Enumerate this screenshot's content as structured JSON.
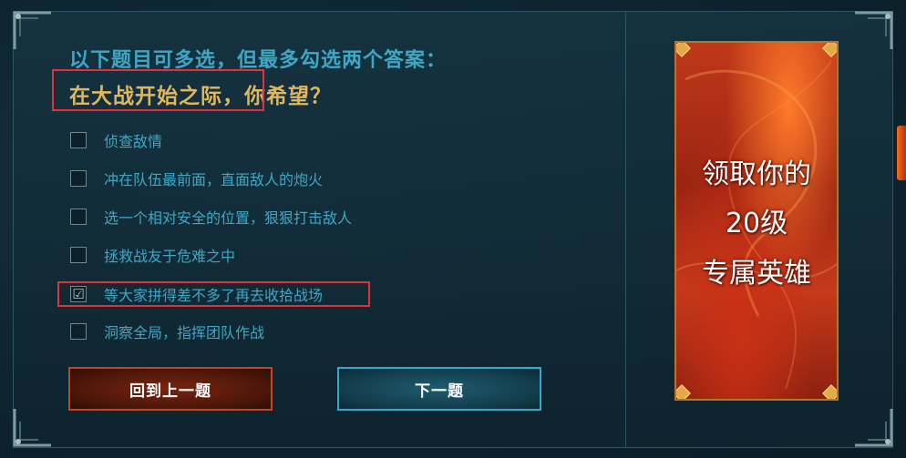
{
  "question": {
    "instruction": "以下题目可多选，但最多勾选两个答案：",
    "prompt_highlight": "在大战开始之际",
    "prompt_rest": "，你希望？"
  },
  "options": [
    {
      "label": "侦查敌情",
      "checked": false
    },
    {
      "label": "冲在队伍最前面，直面敌人的炮火",
      "checked": false
    },
    {
      "label": "选一个相对安全的位置，狠狠打击敌人",
      "checked": false
    },
    {
      "label": "拯救战友于危难之中",
      "checked": false
    },
    {
      "label": "等大家拼得差不多了再去收拾战场",
      "checked": true
    },
    {
      "label": "洞察全局，指挥团队作战",
      "checked": false
    }
  ],
  "checkmark": "☑",
  "buttons": {
    "prev_label": "回到上一题",
    "next_label": "下一题"
  },
  "banner": {
    "line1": "领取你的",
    "line2": "20级",
    "line3": "专属英雄"
  },
  "colors": {
    "accent_blue": "#3fa7c4",
    "accent_gold": "#e0b75f",
    "highlight_red": "#e3303a"
  }
}
